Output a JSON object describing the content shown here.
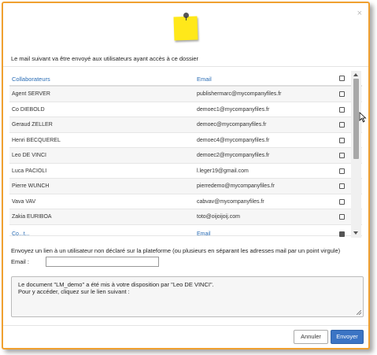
{
  "dialog": {
    "close_label": "×",
    "intro_text": "Le mail suivant va être envoyé aux utilisateurs ayant accès à ce dossier"
  },
  "table": {
    "headers": {
      "collaborateurs": "Collaborateurs",
      "email": "Email"
    },
    "rows": [
      {
        "name": "Agent SERVER",
        "email": "publishermarc@mycompanyfiles.fr"
      },
      {
        "name": "Co DIEBOLD",
        "email": "demoec1@mycompanyfiles.fr"
      },
      {
        "name": "Geraud ZELLER",
        "email": "demoec@mycompanyfiles.fr"
      },
      {
        "name": "Henri BECQUEREL",
        "email": "demoec4@mycompanyfiles.fr"
      },
      {
        "name": "Leo DE VINCI",
        "email": "demoec2@mycompanyfiles.fr"
      },
      {
        "name": "Luca PACIOLI",
        "email": "l.leger19@gmail.com"
      },
      {
        "name": "Pierre WUNCH",
        "email": "pierredemo@mycompanyfiles.fr"
      },
      {
        "name": "Vava VAV",
        "email": "cabvav@mycompanyfiles.fr"
      },
      {
        "name": "Zakia EURIBOA",
        "email": "toto@oijoijoij.com"
      }
    ],
    "partial_row": {
      "name": "Co...t...",
      "email": "Email"
    }
  },
  "invite": {
    "label": "Envoyez un lien à un utilisateur non déclaré sur la plateforme (ou plusieurs en séparant les adresses mail par un point virgule)",
    "email_label": "Email :",
    "email_value": ""
  },
  "message": {
    "line1": "Le document \"LM_demo\" a été mis à votre disposition par \"Leo DE VINCI\".",
    "line2": "Pour y accéder, cliquez sur le lien suivant :"
  },
  "buttons": {
    "cancel": "Annuler",
    "send": "Envoyer"
  },
  "colors": {
    "accent": "#3b74c4",
    "frame": "#f0a030",
    "header_text": "#2a6db5",
    "note": "#ffe81a"
  }
}
